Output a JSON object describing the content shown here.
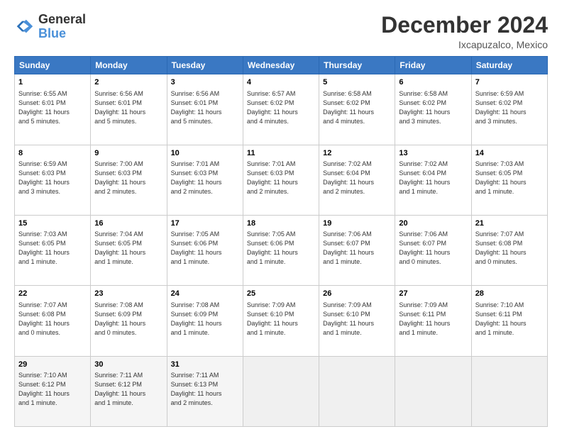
{
  "header": {
    "logo_line1": "General",
    "logo_line2": "Blue",
    "title": "December 2024",
    "subtitle": "Ixcapuzalco, Mexico"
  },
  "calendar": {
    "headers": [
      "Sunday",
      "Monday",
      "Tuesday",
      "Wednesday",
      "Thursday",
      "Friday",
      "Saturday"
    ],
    "weeks": [
      [
        {
          "day": "1",
          "info": "Sunrise: 6:55 AM\nSunset: 6:01 PM\nDaylight: 11 hours\nand 5 minutes."
        },
        {
          "day": "2",
          "info": "Sunrise: 6:56 AM\nSunset: 6:01 PM\nDaylight: 11 hours\nand 5 minutes."
        },
        {
          "day": "3",
          "info": "Sunrise: 6:56 AM\nSunset: 6:01 PM\nDaylight: 11 hours\nand 5 minutes."
        },
        {
          "day": "4",
          "info": "Sunrise: 6:57 AM\nSunset: 6:02 PM\nDaylight: 11 hours\nand 4 minutes."
        },
        {
          "day": "5",
          "info": "Sunrise: 6:58 AM\nSunset: 6:02 PM\nDaylight: 11 hours\nand 4 minutes."
        },
        {
          "day": "6",
          "info": "Sunrise: 6:58 AM\nSunset: 6:02 PM\nDaylight: 11 hours\nand 3 minutes."
        },
        {
          "day": "7",
          "info": "Sunrise: 6:59 AM\nSunset: 6:02 PM\nDaylight: 11 hours\nand 3 minutes."
        }
      ],
      [
        {
          "day": "8",
          "info": "Sunrise: 6:59 AM\nSunset: 6:03 PM\nDaylight: 11 hours\nand 3 minutes."
        },
        {
          "day": "9",
          "info": "Sunrise: 7:00 AM\nSunset: 6:03 PM\nDaylight: 11 hours\nand 2 minutes."
        },
        {
          "day": "10",
          "info": "Sunrise: 7:01 AM\nSunset: 6:03 PM\nDaylight: 11 hours\nand 2 minutes."
        },
        {
          "day": "11",
          "info": "Sunrise: 7:01 AM\nSunset: 6:03 PM\nDaylight: 11 hours\nand 2 minutes."
        },
        {
          "day": "12",
          "info": "Sunrise: 7:02 AM\nSunset: 6:04 PM\nDaylight: 11 hours\nand 2 minutes."
        },
        {
          "day": "13",
          "info": "Sunrise: 7:02 AM\nSunset: 6:04 PM\nDaylight: 11 hours\nand 1 minute."
        },
        {
          "day": "14",
          "info": "Sunrise: 7:03 AM\nSunset: 6:05 PM\nDaylight: 11 hours\nand 1 minute."
        }
      ],
      [
        {
          "day": "15",
          "info": "Sunrise: 7:03 AM\nSunset: 6:05 PM\nDaylight: 11 hours\nand 1 minute."
        },
        {
          "day": "16",
          "info": "Sunrise: 7:04 AM\nSunset: 6:05 PM\nDaylight: 11 hours\nand 1 minute."
        },
        {
          "day": "17",
          "info": "Sunrise: 7:05 AM\nSunset: 6:06 PM\nDaylight: 11 hours\nand 1 minute."
        },
        {
          "day": "18",
          "info": "Sunrise: 7:05 AM\nSunset: 6:06 PM\nDaylight: 11 hours\nand 1 minute."
        },
        {
          "day": "19",
          "info": "Sunrise: 7:06 AM\nSunset: 6:07 PM\nDaylight: 11 hours\nand 1 minute."
        },
        {
          "day": "20",
          "info": "Sunrise: 7:06 AM\nSunset: 6:07 PM\nDaylight: 11 hours\nand 0 minutes."
        },
        {
          "day": "21",
          "info": "Sunrise: 7:07 AM\nSunset: 6:08 PM\nDaylight: 11 hours\nand 0 minutes."
        }
      ],
      [
        {
          "day": "22",
          "info": "Sunrise: 7:07 AM\nSunset: 6:08 PM\nDaylight: 11 hours\nand 0 minutes."
        },
        {
          "day": "23",
          "info": "Sunrise: 7:08 AM\nSunset: 6:09 PM\nDaylight: 11 hours\nand 0 minutes."
        },
        {
          "day": "24",
          "info": "Sunrise: 7:08 AM\nSunset: 6:09 PM\nDaylight: 11 hours\nand 1 minute."
        },
        {
          "day": "25",
          "info": "Sunrise: 7:09 AM\nSunset: 6:10 PM\nDaylight: 11 hours\nand 1 minute."
        },
        {
          "day": "26",
          "info": "Sunrise: 7:09 AM\nSunset: 6:10 PM\nDaylight: 11 hours\nand 1 minute."
        },
        {
          "day": "27",
          "info": "Sunrise: 7:09 AM\nSunset: 6:11 PM\nDaylight: 11 hours\nand 1 minute."
        },
        {
          "day": "28",
          "info": "Sunrise: 7:10 AM\nSunset: 6:11 PM\nDaylight: 11 hours\nand 1 minute."
        }
      ],
      [
        {
          "day": "29",
          "info": "Sunrise: 7:10 AM\nSunset: 6:12 PM\nDaylight: 11 hours\nand 1 minute."
        },
        {
          "day": "30",
          "info": "Sunrise: 7:11 AM\nSunset: 6:12 PM\nDaylight: 11 hours\nand 1 minute."
        },
        {
          "day": "31",
          "info": "Sunrise: 7:11 AM\nSunset: 6:13 PM\nDaylight: 11 hours\nand 2 minutes."
        },
        {
          "day": "",
          "info": ""
        },
        {
          "day": "",
          "info": ""
        },
        {
          "day": "",
          "info": ""
        },
        {
          "day": "",
          "info": ""
        }
      ]
    ]
  }
}
